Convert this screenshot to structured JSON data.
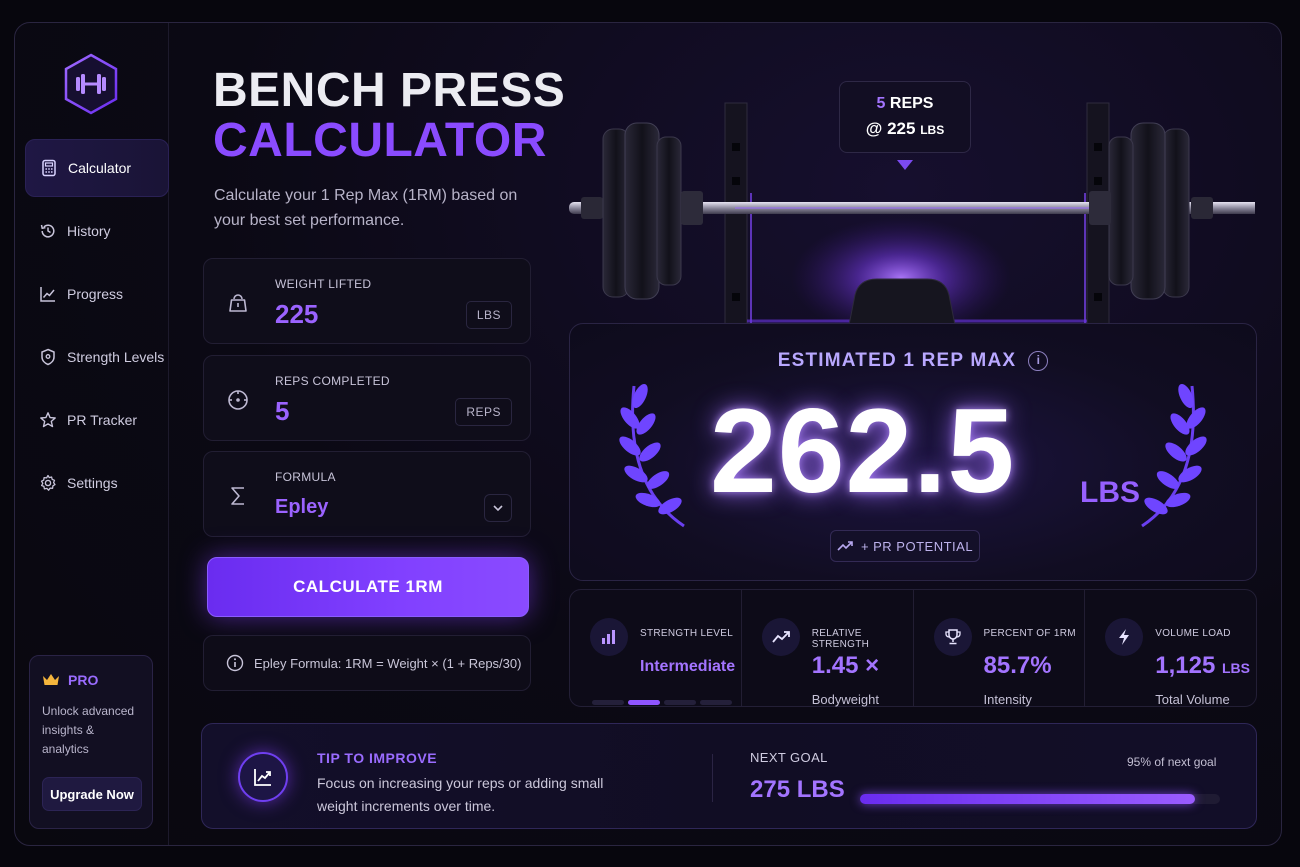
{
  "app": {
    "title_line1": "BENCH PRESS",
    "title_line2": "CALCULATOR",
    "subtitle": "Calculate your 1 Rep Max (1RM) based on your best set performance."
  },
  "sidebar": {
    "items": [
      {
        "label": "Calculator",
        "icon": "calculator-icon",
        "active": true
      },
      {
        "label": "History",
        "icon": "history-icon"
      },
      {
        "label": "Progress",
        "icon": "chart-icon"
      },
      {
        "label": "Strength Levels",
        "icon": "shield-icon"
      },
      {
        "label": "PR Tracker",
        "icon": "star-icon"
      },
      {
        "label": "Settings",
        "icon": "gear-icon"
      }
    ],
    "pro": {
      "title": "PRO",
      "text": "Unlock advanced insights & analytics",
      "button": "Upgrade Now"
    }
  },
  "inputs": {
    "weight": {
      "label": "WEIGHT LIFTED",
      "value": "225",
      "unit": "LBS"
    },
    "reps": {
      "label": "REPS COMPLETED",
      "value": "5",
      "unit": "REPS"
    },
    "formula": {
      "label": "FORMULA",
      "value": "Epley"
    }
  },
  "calculate_label": "CALCULATE 1RM",
  "formula_note": "Epley Formula: 1RM = Weight × (1 + Reps/30)",
  "hero": {
    "reps_count": "5",
    "reps_word": "REPS",
    "at_weight": "@ 225",
    "at_unit": "LBS"
  },
  "result": {
    "label": "ESTIMATED 1 REP MAX",
    "value": "262.5",
    "unit": "LBS",
    "badge": "+ PR POTENTIAL"
  },
  "stats": [
    {
      "label": "STRENGTH LEVEL",
      "value": "Intermediate",
      "level_segments": 4,
      "level_active": 2
    },
    {
      "label": "RELATIVE STRENGTH",
      "value": "1.45 ×",
      "sub": "Bodyweight"
    },
    {
      "label": "PERCENT OF 1RM",
      "value": "85.7%",
      "sub": "Intensity"
    },
    {
      "label": "VOLUME LOAD",
      "value": "1,125",
      "unit": "LBS",
      "sub": "Total Volume"
    }
  ],
  "tip": {
    "title": "TIP TO IMPROVE",
    "text": "Focus on increasing your reps or adding small weight increments over time.",
    "goal_label": "NEXT GOAL",
    "goal_value": "275 LBS",
    "goal_pct_text": "95% of next goal",
    "goal_progress": 0.93
  },
  "colors": {
    "accent": "#8a4bff",
    "accent_light": "#a374ff",
    "bg": "#07060d"
  }
}
